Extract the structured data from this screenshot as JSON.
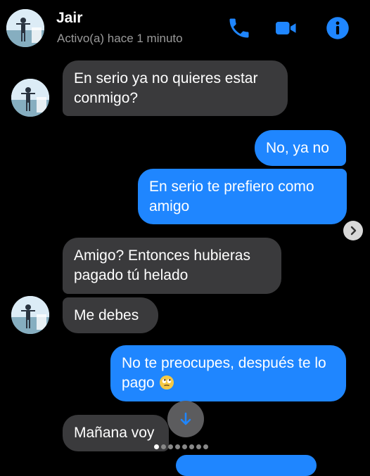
{
  "header": {
    "name": "Jair",
    "status": "Activo(a) hace 1 minuto"
  },
  "icons": {
    "phone": "phone-icon",
    "video": "video-camera-icon",
    "info": "info-icon",
    "next": "chevron-right-icon",
    "scroll_down": "arrow-down-icon",
    "emoji": "rolling-eyes-emoji"
  },
  "colors": {
    "accent": "#1f86ff",
    "incoming_bubble": "#3a3a3c",
    "background": "#000000"
  },
  "messages": [
    {
      "direction": "incoming",
      "text": "En serio ya no quieres estar conmigo?"
    },
    {
      "direction": "outgoing",
      "text": "No, ya no"
    },
    {
      "direction": "outgoing",
      "text": "En serio te prefiero como amigo"
    },
    {
      "direction": "incoming",
      "text": "Amigo? Entonces hubieras pagado tú helado"
    },
    {
      "direction": "incoming",
      "text": "Me debes"
    },
    {
      "direction": "outgoing",
      "text": "No te preocupes, después te lo pago"
    },
    {
      "direction": "incoming",
      "text": "Mañana voy"
    }
  ],
  "pagination": {
    "total": 8,
    "active": 1
  }
}
